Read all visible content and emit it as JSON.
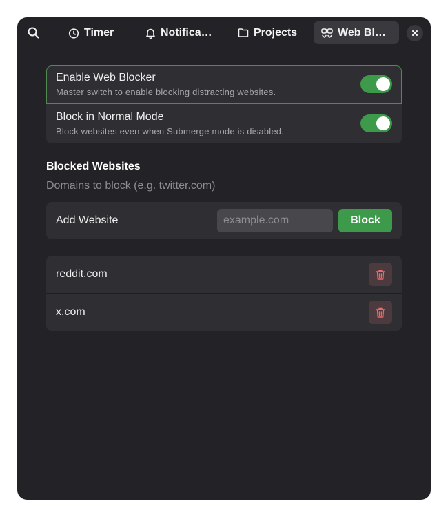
{
  "header": {
    "tabs": [
      {
        "label": "Timer",
        "icon": "clock-icon"
      },
      {
        "label": "Notifica…",
        "icon": "bell-icon"
      },
      {
        "label": "Projects",
        "icon": "folder-icon"
      },
      {
        "label": "Web Bl…",
        "icon": "web-blocker-icon",
        "active": true
      }
    ]
  },
  "settings": [
    {
      "title": "Enable Web Blocker",
      "description": "Master switch to enable blocking distracting websites.",
      "enabled": true
    },
    {
      "title": "Block in Normal Mode",
      "description": "Block websites even when Submerge mode is disabled.",
      "enabled": true
    }
  ],
  "blocked": {
    "title": "Blocked Websites",
    "description": "Domains to block (e.g. twitter.com)",
    "add_label": "Add Website",
    "input_value": "",
    "input_placeholder": "example.com",
    "block_label": "Block",
    "sites": [
      "reddit.com",
      "x.com"
    ]
  },
  "colors": {
    "accent_green": "#3c9a4a",
    "background": "#232227",
    "card": "#2f2e33",
    "danger": "#ef6b6b"
  }
}
